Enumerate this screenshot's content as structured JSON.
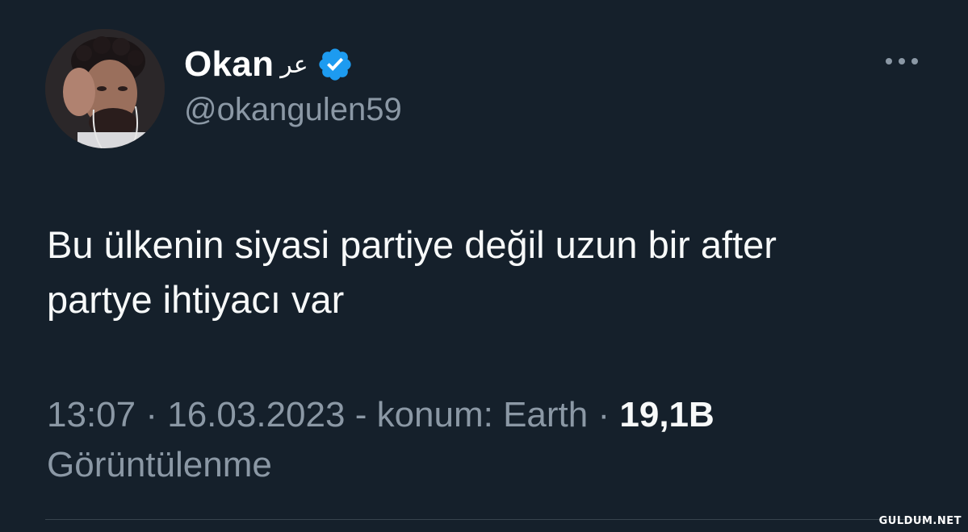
{
  "author": {
    "display_name": "Okan",
    "name_suffix": "ﻋﺮ",
    "handle": "@okangulen59",
    "verified": true
  },
  "tweet": {
    "text_line1": "Bu ülkenin siyasi partiye değil uzun bir after",
    "text_line2": "partye ihtiyacı var"
  },
  "meta": {
    "time": "13:07",
    "separator": "·",
    "date": "16.03.2023",
    "location": "- konum: Earth",
    "views_count": "19,1B",
    "views_label": "Görüntülenme"
  },
  "watermark": "GULDUM.NET",
  "colors": {
    "background": "#15202b",
    "primary_text": "#f7f9f9",
    "secondary_text": "#8b98a5",
    "verified_badge": "#1d9bf0"
  },
  "icons": {
    "more": "more-horizontal-icon",
    "verified": "verified-badge-icon"
  }
}
